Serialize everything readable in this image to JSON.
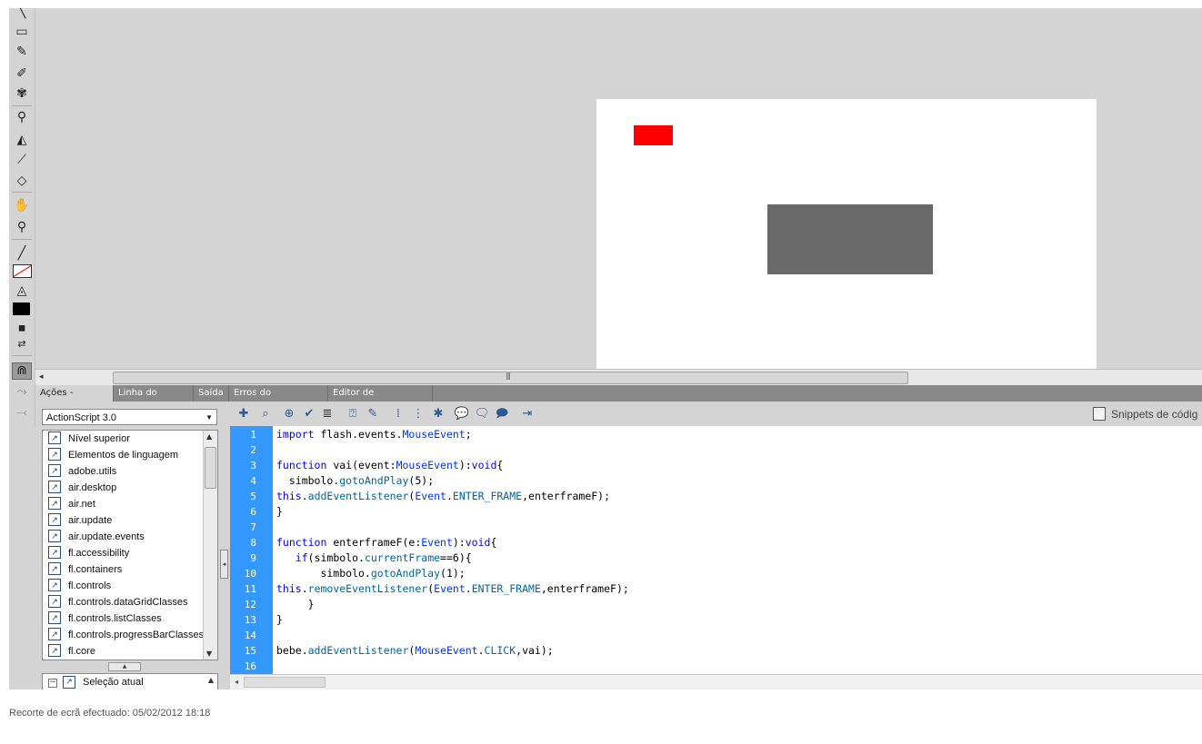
{
  "toolbar": {
    "tools": [
      {
        "name": "line-tool-icon",
        "glyph": "╲"
      },
      {
        "name": "rectangle-tool-icon",
        "glyph": "▭"
      },
      {
        "name": "pencil-tool-icon",
        "glyph": "✎"
      },
      {
        "name": "brush-tool-icon",
        "glyph": "🖌"
      },
      {
        "name": "deco-tool-icon",
        "glyph": "✾"
      },
      {
        "name": "bone-tool-icon",
        "glyph": "⚲"
      },
      {
        "name": "paint-bucket-tool-icon",
        "glyph": "⛽"
      },
      {
        "name": "eyedropper-tool-icon",
        "glyph": "⌁"
      },
      {
        "name": "eraser-tool-icon",
        "glyph": "⌫"
      },
      {
        "name": "hand-tool-icon",
        "glyph": "✋"
      },
      {
        "name": "zoom-tool-icon",
        "glyph": "⌕"
      }
    ],
    "stroke_color": "#000000",
    "fill_color": "#000000"
  },
  "stage": {
    "background": "#ffffff",
    "red_rect_color": "#ff0000",
    "grey_rect_color": "#696969"
  },
  "tabs": [
    "Ações - Quadro",
    "Linha do tempo",
    "Saída",
    "Erros do compilador",
    "Editor de movimento"
  ],
  "actions": {
    "language": "ActionScript 3.0",
    "library": [
      "Nível superior",
      "Elementos de linguagem",
      "adobe.utils",
      "air.desktop",
      "air.net",
      "air.update",
      "air.update.events",
      "fl.accessibility",
      "fl.containers",
      "fl.controls",
      "fl.controls.dataGridClasses",
      "fl.controls.listClasses",
      "fl.controls.progressBarClasses",
      "fl.core"
    ],
    "current_selection": "Seleção atual"
  },
  "editor": {
    "snippets_label": "Snippets de códig",
    "line_numbers": [
      "1",
      "2",
      "3",
      "4",
      "5",
      "6",
      "7",
      "8",
      "9",
      "10",
      "11",
      "12",
      "13",
      "14",
      "15",
      "16"
    ],
    "code": [
      "import flash.events.MouseEvent;",
      "",
      "function vai(event:MouseEvent):void{",
      "  simbolo.gotoAndPlay(5);",
      "this.addEventListener(Event.ENTER_FRAME,enterframeF);",
      "}",
      "",
      "function enterframeF(e:Event):void{",
      "   if(simbolo.currentFrame==6){",
      "       simbolo.gotoAndPlay(1);",
      "this.removeEventListener(Event.ENTER_FRAME,enterframeF);",
      "     }",
      "}",
      "",
      "bebe.addEventListener(MouseEvent.CLICK,vai);",
      ""
    ],
    "gutter_color": "#3399ff"
  },
  "caption": "Recorte de ecrã efectuado: 05/02/2012 18:18"
}
